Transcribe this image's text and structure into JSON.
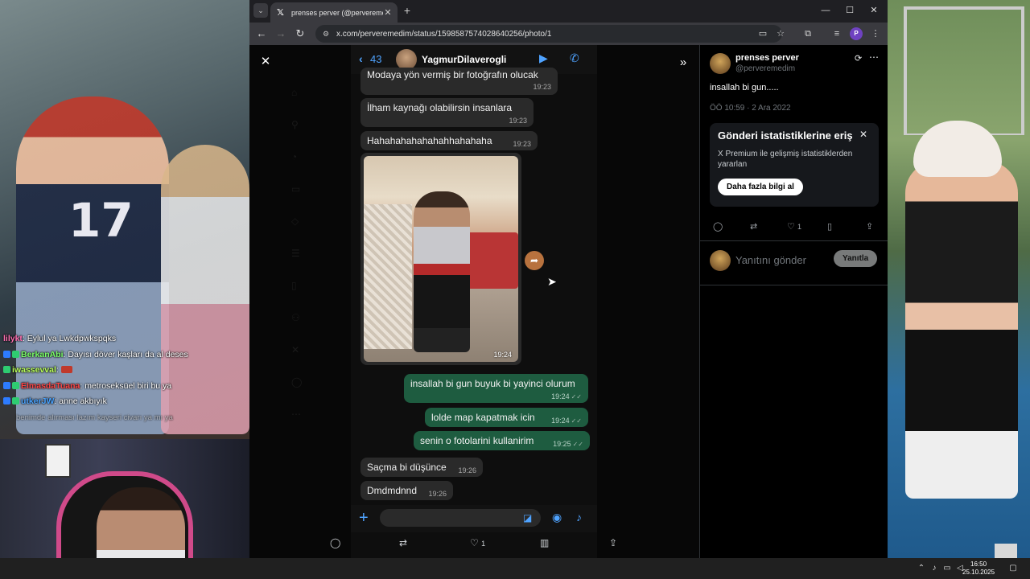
{
  "browser": {
    "tab_title": "prenses perver (@perveremedim",
    "url": "x.com/perveremedim/status/1598587574028640256/photo/1"
  },
  "whatsapp": {
    "unread_count": "43",
    "contact_name": "YagmurDilaverogli",
    "messages": [
      {
        "text": "Modaya yön vermiş bir fotoğrafın olucak",
        "time": "19:23"
      },
      {
        "text": "İlham kaynağı olabilirsin insanlara",
        "time": "19:23"
      },
      {
        "text": "Hahahahahahahahhahahaha",
        "time": "19:23"
      },
      {
        "text": "insallah bi gun buyuk bi yayinci olurum",
        "time": "19:24"
      },
      {
        "text": "lolde map kapatmak icin",
        "time": "19:24"
      },
      {
        "text": "senin o fotolarini kullanirim",
        "time": "19:25"
      },
      {
        "text": "Saçma bi düşünce",
        "time": "19:26"
      },
      {
        "text": "Dmdmdnnd",
        "time": "19:26"
      }
    ],
    "photo_time": "19:24"
  },
  "viewer_actions": {
    "like_count": "1"
  },
  "tweet": {
    "display_name": "prenses perver",
    "handle": "@perveremedim",
    "text": "insallah bi gun.....",
    "date": "ÖÖ 10:59 · 2 Ara 2022",
    "like_count": "1",
    "reply_placeholder": "Yanıtını gönder",
    "reply_button": "Yanıtla"
  },
  "premium_card": {
    "title": "Gönderi istatistiklerine eriş",
    "description": "X Premium ile gelişmiş istatistiklerden yararlan",
    "button": "Daha fazla bilgi al"
  },
  "stream_chat": [
    {
      "user": "lilykt",
      "color": "#ff6fb1",
      "text": "Eylul ya Lwkdpwkspqks"
    },
    {
      "user": "BerkanAbi",
      "color": "#7cff6a",
      "text": "Dayısı döver kaşları da al deses"
    },
    {
      "user": "iwassevval",
      "color": "#b9ff5a",
      "text": ""
    },
    {
      "user": "ElmasdaTuana",
      "color": "#ff4444",
      "text": "metroseksüel biri bu ya"
    },
    {
      "user": "utkerJW",
      "color": "#4aa3ff",
      "text": "anne akbıyık"
    },
    {
      "user": "",
      "color": "#888888",
      "text": "benimde alırması lazım kayseri civarı ya mı ya"
    }
  ],
  "taskbar": {
    "time": "16:50",
    "date": "25.10.2025"
  }
}
